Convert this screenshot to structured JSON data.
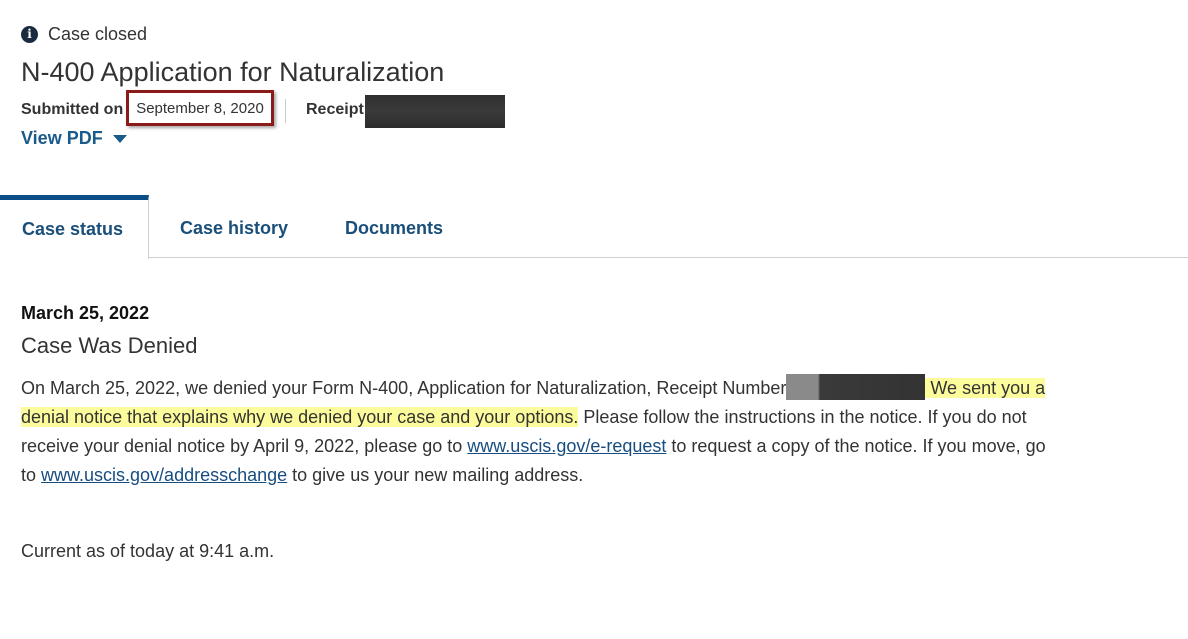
{
  "header": {
    "status": "Case closed",
    "status_icon": "info-icon",
    "title": "N-400 Application for Naturalization",
    "submitted_label": "Submitted on",
    "submitted_date": "September 8, 2020",
    "receipt_label": "Receipt",
    "view_pdf_label": "View PDF"
  },
  "tabs": [
    {
      "label": "Case status",
      "active": true
    },
    {
      "label": "Case history",
      "active": false
    },
    {
      "label": "Documents",
      "active": false
    }
  ],
  "status": {
    "date": "March 25, 2022",
    "title": "Case Was Denied",
    "p1": "On March 25, 2022, we denied your Form N-400, Application for Naturalization, Receipt Number",
    "p2_hl": " We sent you a denial notice that explains why we denied your case and your options.",
    "p3": " Please follow the instructions in the notice. If you do not receive your denial notice by April 9, 2022, please go to ",
    "link1": "www.uscis.gov/e-request",
    "p4": " to request a copy of the notice. If you move, go to ",
    "link2": "www.uscis.gov/addresschange",
    "p5": " to give us your new mailing address.",
    "current_as_of": "Current as of today at 9:41 a.m."
  },
  "colors": {
    "link": "#174d80",
    "tab_active_border": "#0b4f86",
    "highlight": "#fcfc9c",
    "annotation_box": "#8b1a1a"
  }
}
